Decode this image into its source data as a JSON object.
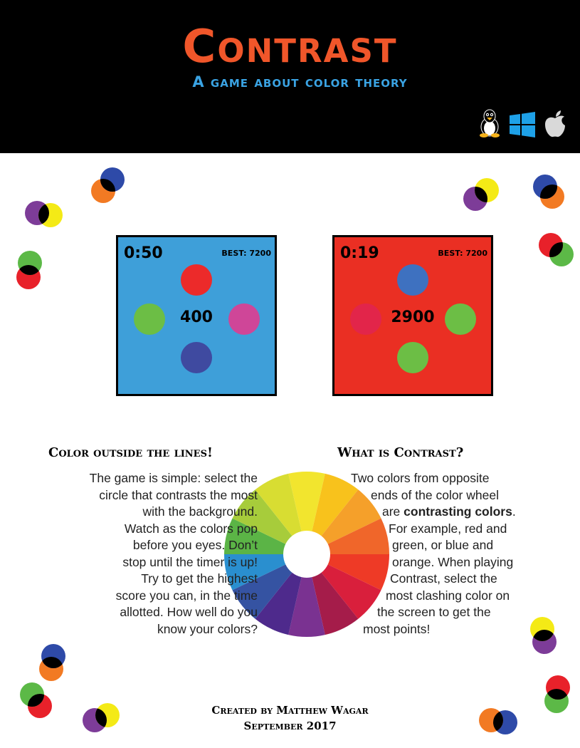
{
  "header": {
    "title": "Contrast",
    "subtitle": "A game about color theory",
    "platform_icons": [
      "linux-tux-icon",
      "windows-icon",
      "apple-icon"
    ]
  },
  "screens": [
    {
      "timer": "0:50",
      "best": "BEST: 7200",
      "score": "400",
      "background": "#3e9fd9",
      "circles": {
        "top": "#ec2a2a",
        "left": "#6cbe45",
        "right": "#cf4698",
        "bottom": "#3f4aa0"
      }
    },
    {
      "timer": "0:19",
      "best": "BEST: 7200",
      "score": "2900",
      "background": "#ea2f23",
      "circles": {
        "top": "#3e71c0",
        "left": "#e2254a",
        "right": "#6cbe45",
        "bottom": "#6cbe45"
      }
    }
  ],
  "left_section": {
    "heading": "Color outside the lines!",
    "lines": [
      "The game is simple: select the",
      "circle that contrasts the most",
      "with the background.",
      "Watch as the colors pop",
      "before you eyes. Don’t",
      "stop until the timer is up!",
      "Try to get the highest",
      "score you can, in the time",
      "allotted. How well do you",
      "know your colors?"
    ]
  },
  "right_section": {
    "heading": "What is Contrast?",
    "lines": [
      "Two colors from opposite",
      "ends of the color wheel",
      "are",
      "contrasting colors",
      ".",
      "For example, red and",
      "green, or blue and",
      "orange. When playing",
      "Contrast, select the",
      "most clashing color on",
      "the screen to get the",
      "most points!"
    ]
  },
  "color_wheel": [
    "#f2e52e",
    "#f8c21c",
    "#f5a02a",
    "#f0662a",
    "#ee3a26",
    "#d91f3c",
    "#a51c4a",
    "#7a3291",
    "#4e2a8c",
    "#3553a2",
    "#2a8fcf",
    "#5bb446",
    "#a7cc3b",
    "#d8dd32"
  ],
  "footer": {
    "line1": "Created by Matthew Wagar",
    "line2": "September 2017"
  }
}
